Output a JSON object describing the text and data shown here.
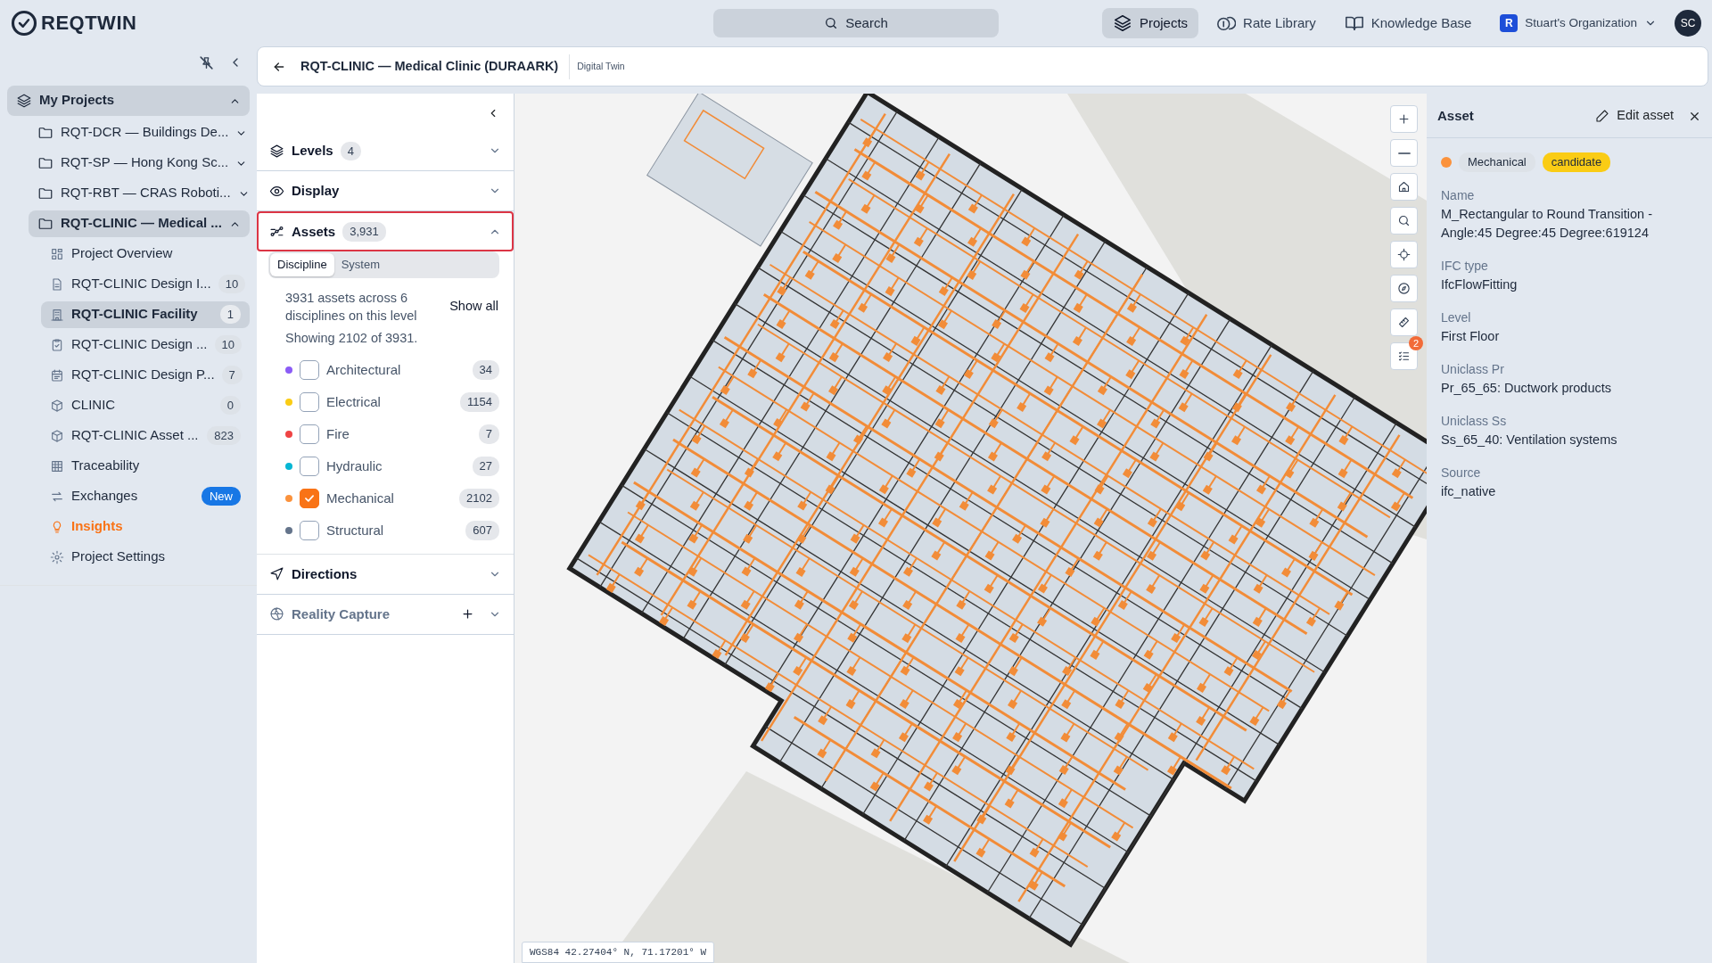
{
  "app": {
    "logo": "REQTWIN",
    "search": "Search",
    "nav": [
      {
        "label": "Projects",
        "selected": true
      },
      {
        "label": "Rate Library",
        "selected": false
      },
      {
        "label": "Knowledge Base",
        "selected": false
      }
    ],
    "organization": "Stuart's Organization",
    "org_badge": "R",
    "avatar": "SC"
  },
  "sidebar": {
    "root": {
      "label": "My Projects",
      "expanded": true
    },
    "projects": [
      {
        "label": "RQT-DCR — Buildings De...",
        "expanded": false,
        "selected": false
      },
      {
        "label": "RQT-SP — Hong Kong Sc...",
        "expanded": false,
        "selected": false
      },
      {
        "label": "RQT-RBT — CRAS Roboti...",
        "expanded": false,
        "selected": false
      },
      {
        "label": "RQT-CLINIC — Medical ...",
        "expanded": true,
        "selected": true,
        "children": [
          {
            "label": "Project Overview",
            "selected": false,
            "accent": false
          },
          {
            "label": "RQT-CLINIC Design I...",
            "count": "10",
            "selected": false,
            "accent": false
          },
          {
            "label": "RQT-CLINIC Facility",
            "count": "1",
            "selected": true,
            "accent": false
          },
          {
            "label": "RQT-CLINIC Design ...",
            "count": "10",
            "selected": false,
            "accent": false
          },
          {
            "label": "RQT-CLINIC Design P...",
            "count": "7",
            "selected": false,
            "accent": false
          },
          {
            "label": "CLINIC",
            "count": "0",
            "selected": false,
            "accent": false
          },
          {
            "label": "RQT-CLINIC Asset ...",
            "count": "823",
            "selected": false,
            "accent": false
          },
          {
            "label": "Traceability",
            "selected": false,
            "accent": false
          },
          {
            "label": "Exchanges",
            "tag": "New",
            "selected": false,
            "accent": false
          },
          {
            "label": "Insights",
            "selected": false,
            "accent": true
          },
          {
            "label": "Project Settings",
            "selected": false,
            "accent": false
          }
        ]
      }
    ]
  },
  "header": {
    "title": "RQT-CLINIC — Medical Clinic (DURAARK)",
    "subtitle": "Digital Twin"
  },
  "panel": {
    "sections": [
      {
        "label": "Levels",
        "count": "4",
        "expanded": false,
        "highlighted": false,
        "disabled": false
      },
      {
        "label": "Display",
        "expanded": false,
        "highlighted": false,
        "disabled": false
      },
      {
        "label": "Assets",
        "count": "3,931",
        "expanded": true,
        "highlighted": true,
        "disabled": false,
        "tabs": [
          {
            "label": "Discipline",
            "selected": true
          },
          {
            "label": "System",
            "selected": false
          }
        ],
        "summary": "3931 assets across 6 disciplines on this level",
        "show_all": "Show all",
        "showing": "Showing 2102 of 3931.",
        "disciplines": [
          {
            "label": "Architectural",
            "color": "#8b5cf6",
            "checked": false,
            "count": "34"
          },
          {
            "label": "Electrical",
            "color": "#facc15",
            "checked": false,
            "count": "1154"
          },
          {
            "label": "Fire",
            "color": "#ef4444",
            "checked": false,
            "count": "7"
          },
          {
            "label": "Hydraulic",
            "color": "#06b6d4",
            "checked": false,
            "count": "27"
          },
          {
            "label": "Mechanical",
            "color": "#fb923c",
            "checked": true,
            "count": "2102"
          },
          {
            "label": "Structural",
            "color": "#64748b",
            "checked": false,
            "count": "607"
          }
        ]
      },
      {
        "label": "Directions",
        "expanded": false,
        "highlighted": false,
        "disabled": false
      },
      {
        "label": "Reality Capture",
        "expanded": false,
        "highlighted": false,
        "disabled": true
      }
    ]
  },
  "map": {
    "coordinates": "WGS84 42.27404° N, 71.17201° W",
    "issues_badge": "2"
  },
  "asset": {
    "title": "Asset",
    "edit": "Edit asset",
    "discipline": "Mechanical",
    "status": "candidate",
    "fields": [
      {
        "label": "Name",
        "value": "M_Rectangular to Round Transition - Angle:45 Degree:45 Degree:619124"
      },
      {
        "label": "IFC type",
        "value": "IfcFlowFitting"
      },
      {
        "label": "Level",
        "value": "First Floor"
      },
      {
        "label": "Uniclass Pr",
        "value": "Pr_65_65: Ductwork products"
      },
      {
        "label": "Uniclass Ss",
        "value": "Ss_65_40: Ventilation systems"
      },
      {
        "label": "Source",
        "value": "ifc_native"
      }
    ]
  }
}
